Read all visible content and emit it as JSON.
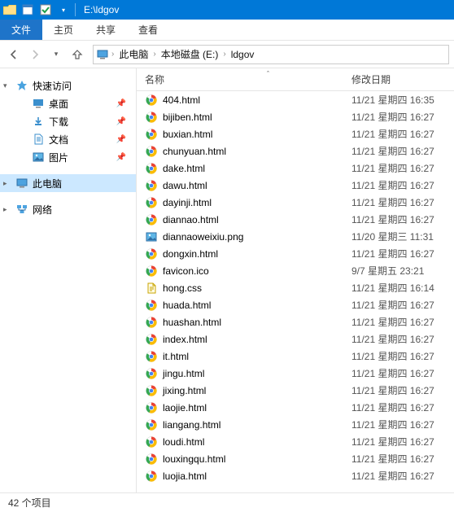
{
  "titlebar": {
    "path": "E:\\ldgov"
  },
  "ribbon": {
    "file": "文件",
    "tabs": [
      "主页",
      "共享",
      "查看"
    ]
  },
  "breadcrumb": {
    "items": [
      "此电脑",
      "本地磁盘 (E:)",
      "ldgov"
    ]
  },
  "sidebar": {
    "quick": {
      "label": "快速访问"
    },
    "quick_items": [
      {
        "label": "桌面",
        "icon": "desktop"
      },
      {
        "label": "下载",
        "icon": "download"
      },
      {
        "label": "文档",
        "icon": "document"
      },
      {
        "label": "图片",
        "icon": "picture"
      }
    ],
    "thispc": "此电脑",
    "network": "网络"
  },
  "columns": {
    "name": "名称",
    "date": "修改日期"
  },
  "files": [
    {
      "name": "404.html",
      "date": "11/21 星期四 16:35",
      "icon": "chrome"
    },
    {
      "name": "bijiben.html",
      "date": "11/21 星期四 16:27",
      "icon": "chrome"
    },
    {
      "name": "buxian.html",
      "date": "11/21 星期四 16:27",
      "icon": "chrome"
    },
    {
      "name": "chunyuan.html",
      "date": "11/21 星期四 16:27",
      "icon": "chrome"
    },
    {
      "name": "dake.html",
      "date": "11/21 星期四 16:27",
      "icon": "chrome"
    },
    {
      "name": "dawu.html",
      "date": "11/21 星期四 16:27",
      "icon": "chrome"
    },
    {
      "name": "dayinji.html",
      "date": "11/21 星期四 16:27",
      "icon": "chrome"
    },
    {
      "name": "diannao.html",
      "date": "11/21 星期四 16:27",
      "icon": "chrome"
    },
    {
      "name": "diannaoweixiu.png",
      "date": "11/20 星期三 11:31",
      "icon": "image"
    },
    {
      "name": "dongxin.html",
      "date": "11/21 星期四 16:27",
      "icon": "chrome"
    },
    {
      "name": "favicon.ico",
      "date": "9/7 星期五 23:21",
      "icon": "chrome"
    },
    {
      "name": "hong.css",
      "date": "11/21 星期四 16:14",
      "icon": "css"
    },
    {
      "name": "huada.html",
      "date": "11/21 星期四 16:27",
      "icon": "chrome"
    },
    {
      "name": "huashan.html",
      "date": "11/21 星期四 16:27",
      "icon": "chrome"
    },
    {
      "name": "index.html",
      "date": "11/21 星期四 16:27",
      "icon": "chrome"
    },
    {
      "name": "it.html",
      "date": "11/21 星期四 16:27",
      "icon": "chrome"
    },
    {
      "name": "jingu.html",
      "date": "11/21 星期四 16:27",
      "icon": "chrome"
    },
    {
      "name": "jixing.html",
      "date": "11/21 星期四 16:27",
      "icon": "chrome"
    },
    {
      "name": "laojie.html",
      "date": "11/21 星期四 16:27",
      "icon": "chrome"
    },
    {
      "name": "liangang.html",
      "date": "11/21 星期四 16:27",
      "icon": "chrome"
    },
    {
      "name": "loudi.html",
      "date": "11/21 星期四 16:27",
      "icon": "chrome"
    },
    {
      "name": "louxingqu.html",
      "date": "11/21 星期四 16:27",
      "icon": "chrome"
    },
    {
      "name": "luojia.html",
      "date": "11/21 星期四 16:27",
      "icon": "chrome"
    }
  ],
  "status": {
    "count": "42 个项目"
  }
}
